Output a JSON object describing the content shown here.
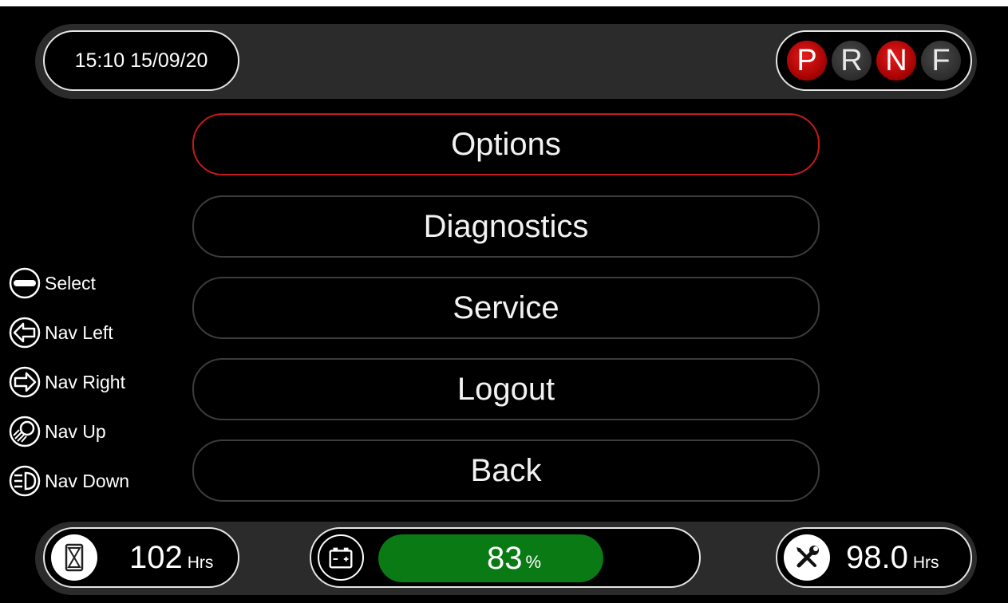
{
  "header": {
    "datetime": "15:10 15/09/20"
  },
  "gear_selector": [
    {
      "letter": "P",
      "state": "on"
    },
    {
      "letter": "R",
      "state": "off"
    },
    {
      "letter": "N",
      "state": "on"
    },
    {
      "letter": "F",
      "state": "off"
    }
  ],
  "menu": {
    "items": [
      "Options",
      "Diagnostics",
      "Service",
      "Logout",
      "Back"
    ],
    "selected": "Options"
  },
  "key_legend": [
    {
      "icon": "minus-circle-icon",
      "label": "Select"
    },
    {
      "icon": "arrow-left-icon",
      "label": "Nav Left"
    },
    {
      "icon": "arrow-right-icon",
      "label": "Nav Right"
    },
    {
      "icon": "work-light-icon",
      "label": "Nav Up"
    },
    {
      "icon": "headlight-icon",
      "label": "Nav Down"
    }
  ],
  "footer": {
    "hour_meter": {
      "value": "102",
      "unit": "Hrs",
      "icon": "hourglass-icon"
    },
    "battery": {
      "value": "83",
      "unit": "%",
      "level": 0.83,
      "icon": "battery-icon"
    },
    "service": {
      "value": "98.0",
      "unit": "Hrs",
      "icon": "wrench-screwdriver-icon"
    }
  },
  "colors": {
    "accent_red": "#c41a1a",
    "battery_green": "#0a7a14",
    "bar_grey": "#2b2b2b"
  }
}
